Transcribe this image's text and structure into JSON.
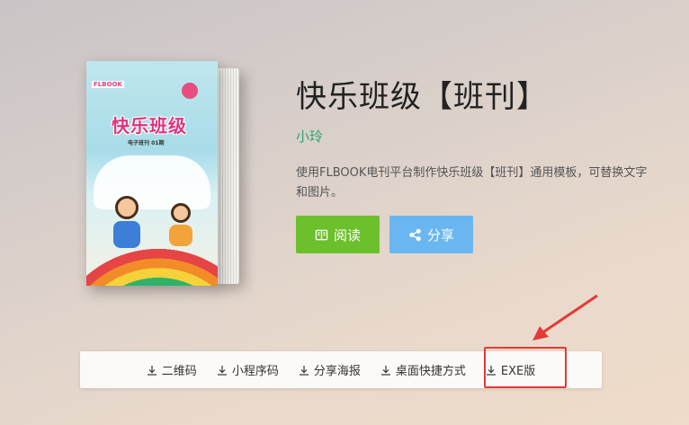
{
  "book": {
    "cover_tag": "FLBOOK",
    "cover_title": "快乐班级",
    "cover_subtitle": "电子班刊 01期"
  },
  "info": {
    "title": "快乐班级【班刊】",
    "author": "小玲",
    "description": "使用FLBOOK电刊平台制作快乐班级【班刊】通用模板，可替换文字和图片。"
  },
  "actions": {
    "read_label": "阅读",
    "share_label": "分享"
  },
  "downloads": {
    "items": [
      {
        "label": "二维码"
      },
      {
        "label": "小程序码"
      },
      {
        "label": "分享海报"
      },
      {
        "label": "桌面快捷方式"
      },
      {
        "label": "EXE版"
      }
    ]
  },
  "colors": {
    "read": "#6cc02b",
    "share": "#6ab6f0",
    "author": "#2aa46b",
    "highlight": "#e53935"
  }
}
